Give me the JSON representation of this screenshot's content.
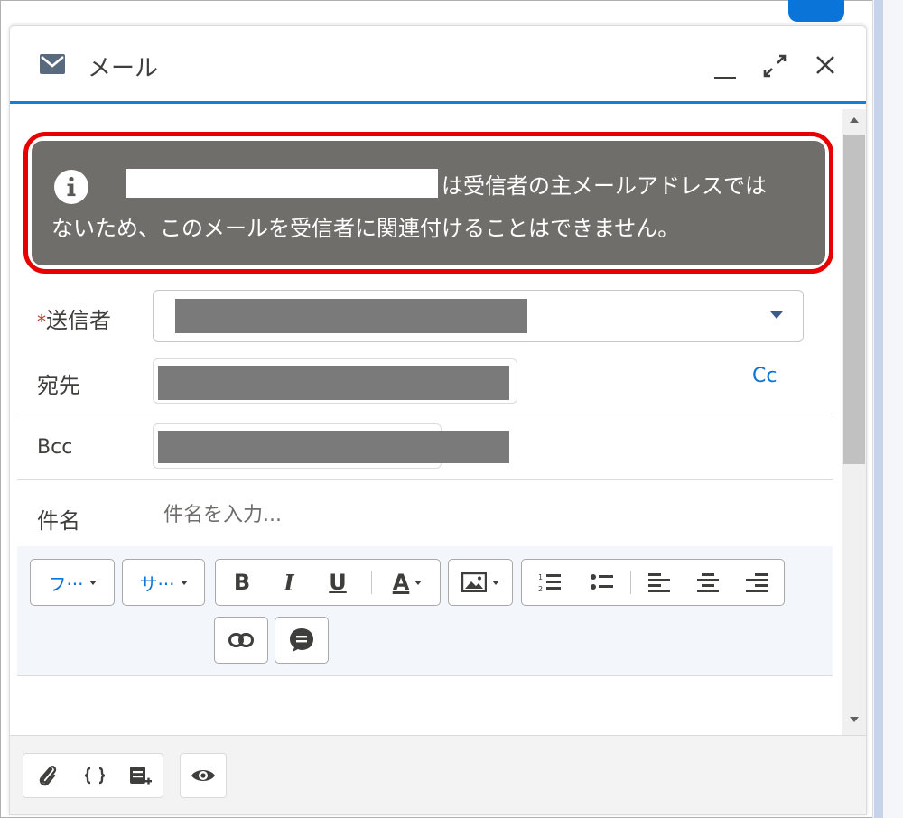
{
  "composer": {
    "title": "メール",
    "header_icons": [
      "mail-icon",
      "minimize-icon",
      "expand-icon",
      "close-icon"
    ]
  },
  "alert": {
    "line1": "は受信者の主メールアドレスでは",
    "line2": "ないため、このメールを受信者に関連付けることはできません。",
    "icon": "info-icon"
  },
  "fields": {
    "from_label": "送信者",
    "from_required_mark": "*",
    "to_label": "宛先",
    "cc_link": "Cc",
    "bcc_label": "Bcc",
    "subject_label": "件名",
    "subject_placeholder": "件名を入力...",
    "subject_value": ""
  },
  "toolbar": {
    "font_family": "フ···",
    "font_size": "サ···",
    "bold": "B",
    "italic": "I",
    "underline": "U",
    "text_color": "A",
    "icons": [
      "image-icon",
      "numbered-list-icon",
      "bullet-list-icon",
      "align-left-icon",
      "align-center-icon",
      "align-right-icon",
      "link-icon",
      "quick-text-icon"
    ]
  },
  "footer": {
    "icons": [
      "attach-icon",
      "merge-field-icon",
      "template-icon",
      "preview-icon"
    ]
  },
  "colors": {
    "accent": "#1b7dd1",
    "alert_bg": "#706e6b",
    "alert_highlight": "#e80000",
    "link": "#0b74d8",
    "required": "#c23934"
  }
}
